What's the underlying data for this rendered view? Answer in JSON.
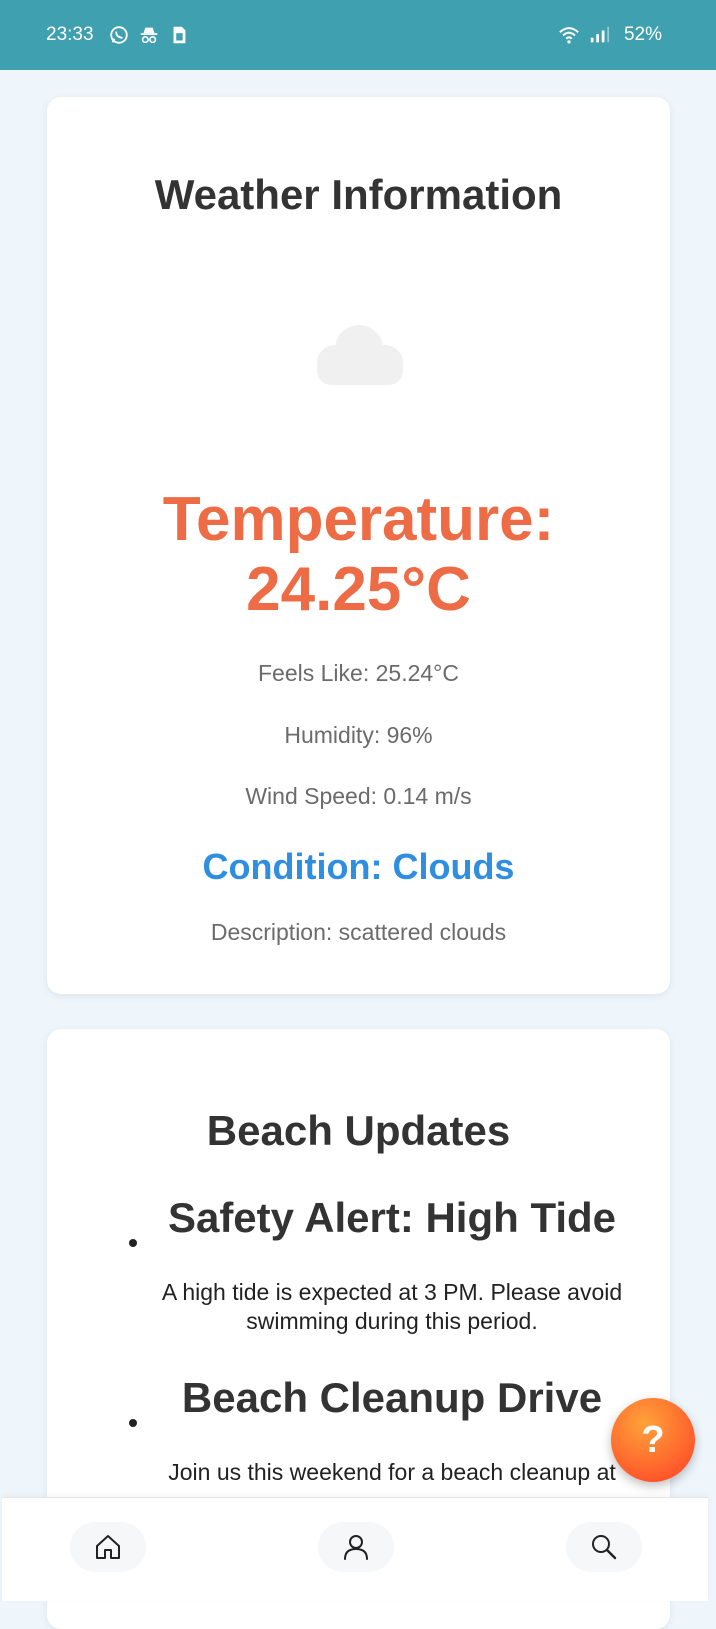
{
  "status_bar": {
    "time": "23:33",
    "left_icons": [
      "whatsapp-icon",
      "incognito-icon",
      "sim-card-icon"
    ],
    "right_icons": [
      "wifi-icon",
      "signal-icon"
    ],
    "battery": "52%"
  },
  "weather": {
    "title": "Weather Information",
    "icon": "cloud-icon",
    "temperature": "Temperature: 24.25°C",
    "feels_like": "Feels Like: 25.24°C",
    "humidity": "Humidity: 96%",
    "wind_speed": "Wind Speed: 0.14 m/s",
    "condition": "Condition: Clouds",
    "description": "Description: scattered clouds"
  },
  "beach": {
    "title": "Beach Updates",
    "items": [
      {
        "title": "Safety Alert: High Tide",
        "body": "A high tide is expected at 3 PM. Please avoid swimming during this period."
      },
      {
        "title": "Beach Cleanup Drive",
        "body": "Join us this weekend for a beach cleanup at"
      }
    ]
  },
  "fab": {
    "label": "?"
  },
  "bottom_nav": {
    "items": [
      "home-icon",
      "profile-icon",
      "search-icon"
    ]
  },
  "colors": {
    "status_bar": "#3fa0b0",
    "background": "#eef6fc",
    "temperature": "#ee6c45",
    "condition": "#2f8ee0",
    "fab": "#ff6b2e"
  }
}
